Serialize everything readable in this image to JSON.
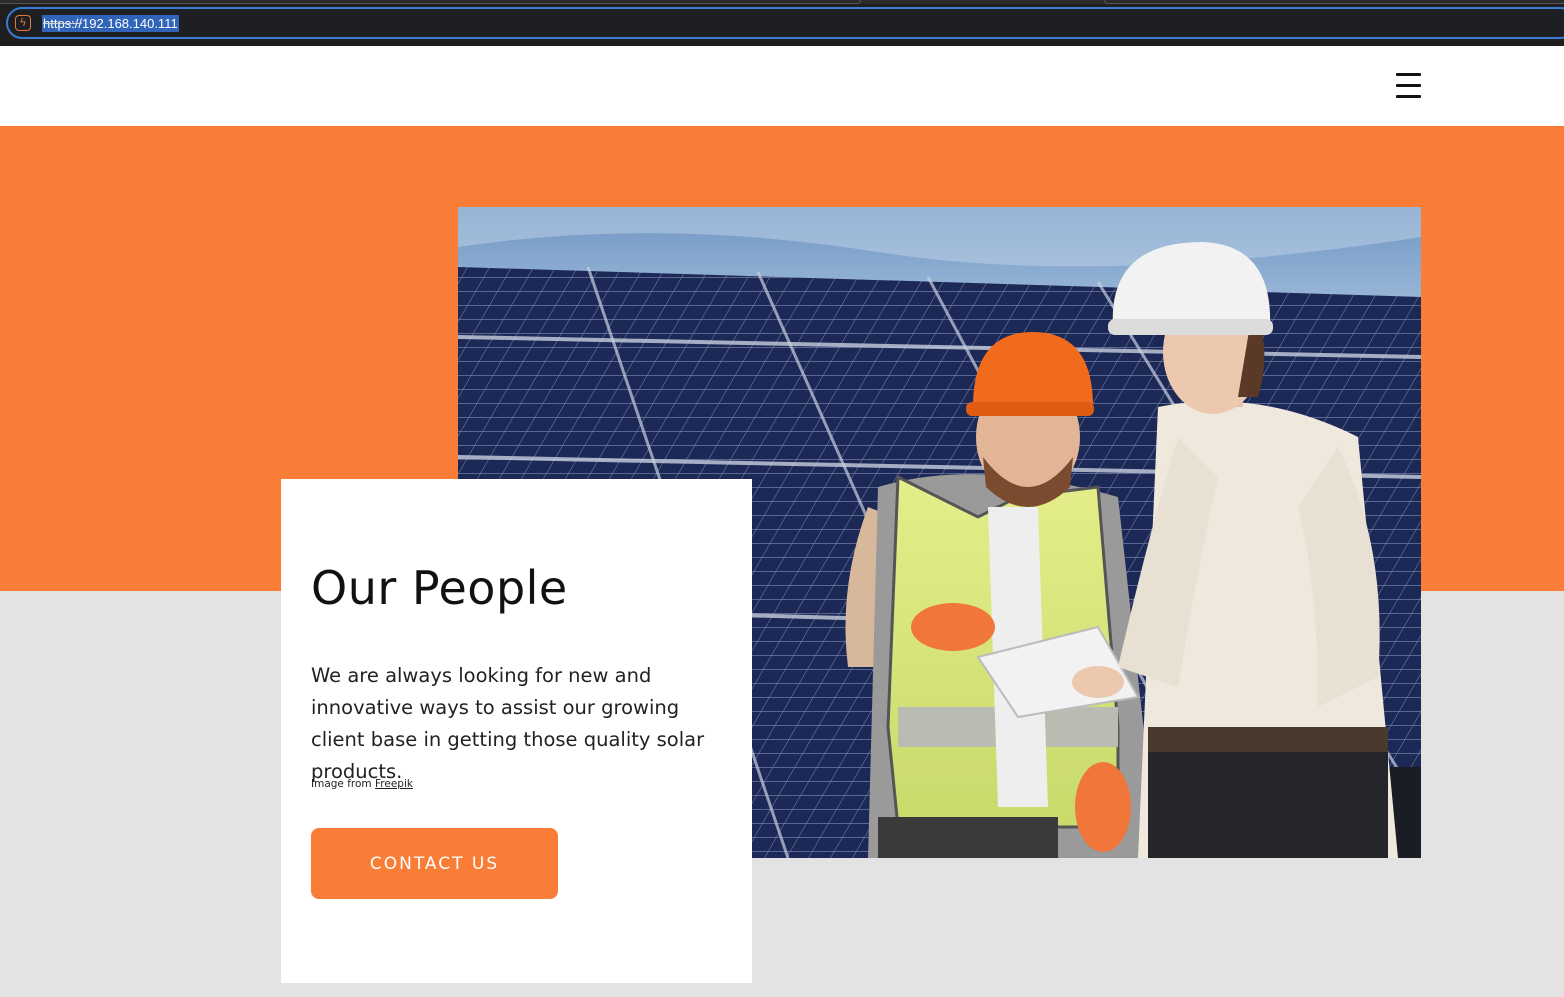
{
  "browser": {
    "url_scheme": "https://",
    "url_host": "192.168.140.111",
    "site_icon_glyph": "ϟ"
  },
  "header": {
    "menu_icon": "hamburger-menu-icon"
  },
  "hero": {
    "title": "Our People",
    "description": "We are always looking for new and innovative ways to assist our growing client base in getting those quality solar products.",
    "credit_prefix": "Image from",
    "credit_link": "Freepik",
    "button_label": "CONTACT US"
  },
  "colors": {
    "accent": "#f97d37",
    "background": "#e3e3e3",
    "card": "#ffffff"
  }
}
